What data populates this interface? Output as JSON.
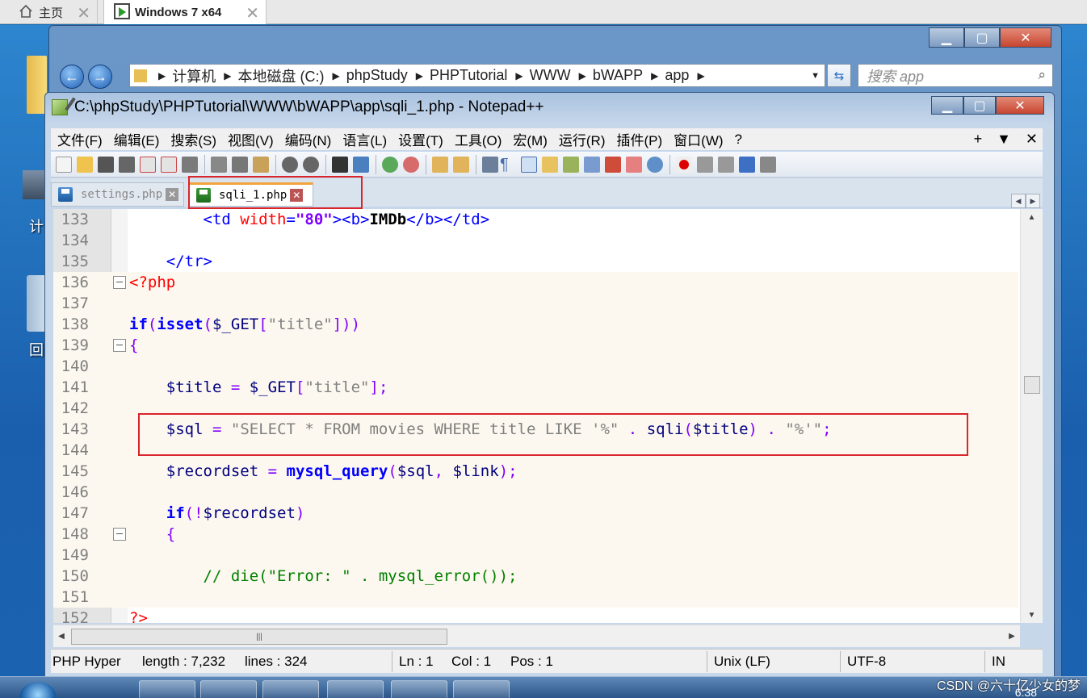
{
  "vm_tabs": {
    "home": "主页",
    "active": "Windows 7 x64",
    "close_glyph": "✕"
  },
  "explorer": {
    "breadcrumbs": [
      "计算机",
      "本地磁盘 (C:)",
      "phpStudy",
      "PHPTutorial",
      "WWW",
      "bWAPP",
      "app"
    ],
    "search_placeholder": "搜索 app"
  },
  "desktop": {
    "label_computer": "计",
    "label_bin": "回"
  },
  "npp": {
    "title": "C:\\phpStudy\\PHPTutorial\\WWW\\bWAPP\\app\\sqli_1.php - Notepad++",
    "menu": [
      "文件(F)",
      "编辑(E)",
      "搜索(S)",
      "视图(V)",
      "编码(N)",
      "语言(L)",
      "设置(T)",
      "工具(O)",
      "宏(M)",
      "运行(R)",
      "插件(P)",
      "窗口(W)",
      "?"
    ],
    "menu_right": [
      "+",
      "▼",
      "✕"
    ],
    "tabs": [
      {
        "label": "settings.php",
        "active": false
      },
      {
        "label": "sqli_1.php",
        "active": true
      }
    ],
    "code": [
      {
        "n": "133",
        "tokens": [
          [
            "t-plain",
            "        "
          ],
          [
            "t-tag",
            "<td "
          ],
          [
            "t-attr",
            "width"
          ],
          [
            "t-tag",
            "="
          ],
          [
            "t-val",
            "\"80\""
          ],
          [
            "t-tag",
            "><b>"
          ],
          [
            "t-bold",
            "IMDb"
          ],
          [
            "t-tag",
            "</b></td>"
          ]
        ]
      },
      {
        "n": "134",
        "tokens": []
      },
      {
        "n": "135",
        "tokens": [
          [
            "t-plain",
            "    "
          ],
          [
            "t-tag",
            "</tr>"
          ]
        ]
      },
      {
        "n": "136",
        "tokens": [
          [
            "t-php",
            "<?php"
          ]
        ]
      },
      {
        "n": "137",
        "tokens": []
      },
      {
        "n": "138",
        "tokens": [
          [
            "t-kw",
            "if"
          ],
          [
            "t-op",
            "("
          ],
          [
            "t-kw",
            "isset"
          ],
          [
            "t-op",
            "("
          ],
          [
            "t-var",
            "$_GET"
          ],
          [
            "t-op",
            "["
          ],
          [
            "t-str",
            "\"title\""
          ],
          [
            "t-op",
            "]))"
          ]
        ]
      },
      {
        "n": "139",
        "tokens": [
          [
            "t-op",
            "{"
          ]
        ]
      },
      {
        "n": "140",
        "tokens": []
      },
      {
        "n": "141",
        "tokens": [
          [
            "t-plain",
            "    "
          ],
          [
            "t-var",
            "$title"
          ],
          [
            "t-plain",
            " "
          ],
          [
            "t-op",
            "="
          ],
          [
            "t-plain",
            " "
          ],
          [
            "t-var",
            "$_GET"
          ],
          [
            "t-op",
            "["
          ],
          [
            "t-str",
            "\"title\""
          ],
          [
            "t-op",
            "];"
          ]
        ]
      },
      {
        "n": "142",
        "tokens": []
      },
      {
        "n": "143",
        "tokens": [
          [
            "t-plain",
            "    "
          ],
          [
            "t-var",
            "$sql"
          ],
          [
            "t-plain",
            " "
          ],
          [
            "t-op",
            "="
          ],
          [
            "t-plain",
            " "
          ],
          [
            "t-str",
            "\"SELECT * FROM movies WHERE title LIKE '%\""
          ],
          [
            "t-plain",
            " "
          ],
          [
            "t-op",
            "."
          ],
          [
            "t-plain",
            " "
          ],
          [
            "t-var",
            "sqli"
          ],
          [
            "t-op",
            "("
          ],
          [
            "t-var",
            "$title"
          ],
          [
            "t-op",
            ")"
          ],
          [
            "t-plain",
            " "
          ],
          [
            "t-op",
            "."
          ],
          [
            "t-plain",
            " "
          ],
          [
            "t-str",
            "\"%'\""
          ],
          [
            "t-op",
            ";"
          ]
        ]
      },
      {
        "n": "144",
        "tokens": []
      },
      {
        "n": "145",
        "tokens": [
          [
            "t-plain",
            "    "
          ],
          [
            "t-var",
            "$recordset"
          ],
          [
            "t-plain",
            " "
          ],
          [
            "t-op",
            "="
          ],
          [
            "t-plain",
            " "
          ],
          [
            "t-kw",
            "mysql_query"
          ],
          [
            "t-op",
            "("
          ],
          [
            "t-var",
            "$sql"
          ],
          [
            "t-op",
            ","
          ],
          [
            "t-plain",
            " "
          ],
          [
            "t-var",
            "$link"
          ],
          [
            "t-op",
            ");"
          ]
        ]
      },
      {
        "n": "146",
        "tokens": []
      },
      {
        "n": "147",
        "tokens": [
          [
            "t-plain",
            "    "
          ],
          [
            "t-kw",
            "if"
          ],
          [
            "t-op",
            "(!"
          ],
          [
            "t-var",
            "$recordset"
          ],
          [
            "t-op",
            ")"
          ]
        ]
      },
      {
        "n": "148",
        "tokens": [
          [
            "t-plain",
            "    "
          ],
          [
            "t-op",
            "{"
          ]
        ]
      },
      {
        "n": "149",
        "tokens": []
      },
      {
        "n": "150",
        "tokens": [
          [
            "t-plain",
            "        "
          ],
          [
            "t-cmt",
            "// die(\"Error: \" . mysql_error());"
          ]
        ]
      },
      {
        "n": "151",
        "tokens": []
      },
      {
        "n": "152",
        "tokens": [
          [
            "t-php",
            "?>"
          ]
        ]
      }
    ],
    "status": {
      "lang": "PHP Hyper",
      "length": "length : 7,232",
      "lines": "lines : 324",
      "ln": "Ln : 1",
      "col": "Col : 1",
      "pos": "Pos : 1",
      "eol": "Unix (LF)",
      "encoding": "UTF-8",
      "mode": "IN"
    }
  },
  "taskbar": {
    "watermark": "CSDN @六十亿少女的梦",
    "clock": "6:38"
  }
}
